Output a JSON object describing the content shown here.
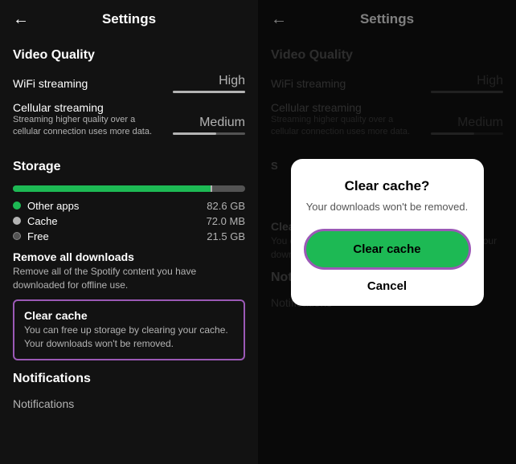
{
  "left": {
    "header": {
      "back_label": "←",
      "title": "Settings"
    },
    "video_quality": {
      "section_title": "Video Quality",
      "wifi_streaming": {
        "label": "WiFi streaming",
        "value": "High"
      },
      "cellular_streaming": {
        "label": "Cellular streaming",
        "sub": "Streaming higher quality over a cellular connection uses more data.",
        "value": "Medium"
      }
    },
    "storage": {
      "section_title": "Storage",
      "other_apps": {
        "label": "Other apps",
        "value": "82.6 GB",
        "color": "#1db954"
      },
      "cache": {
        "label": "Cache",
        "value": "72.0 MB",
        "color": "#b3b3b3"
      },
      "free": {
        "label": "Free",
        "value": "21.5 GB",
        "color": "#535353"
      }
    },
    "remove_downloads": {
      "title": "Remove all downloads",
      "desc": "Remove all of the Spotify content you have downloaded for offline use."
    },
    "clear_cache": {
      "title": "Clear cache",
      "desc": "You can free up storage by clearing your cache. Your downloads won't be removed."
    },
    "notifications": {
      "section_title": "Notifications",
      "item_label": "Notifications"
    }
  },
  "right": {
    "header": {
      "back_label": "←",
      "title": "Settings"
    },
    "video_quality": {
      "section_title": "Video Quality",
      "wifi_streaming": {
        "label": "WiFi streaming",
        "value": "High"
      },
      "cellular_streaming": {
        "label": "Cellular streaming",
        "sub": "Streaming higher quality over a cellular connection uses more data.",
        "value": "Medium"
      }
    },
    "storage": {
      "section_title": "S"
    },
    "clear_cache_bg": {
      "title": "Clear cache",
      "desc": "You can free up storage by clearing your cache. Your downloads won't be removed."
    },
    "notifications": {
      "section_title": "Notifications",
      "item_label": "Notifications"
    },
    "dialog": {
      "title": "Clear cache?",
      "desc": "Your downloads won't be removed.",
      "primary_btn": "Clear cache",
      "cancel_btn": "Cancel"
    }
  },
  "icons": {
    "back": "←",
    "dot_green": "#1db954",
    "dot_gray": "#b3b3b3",
    "dot_dark": "#535353"
  }
}
